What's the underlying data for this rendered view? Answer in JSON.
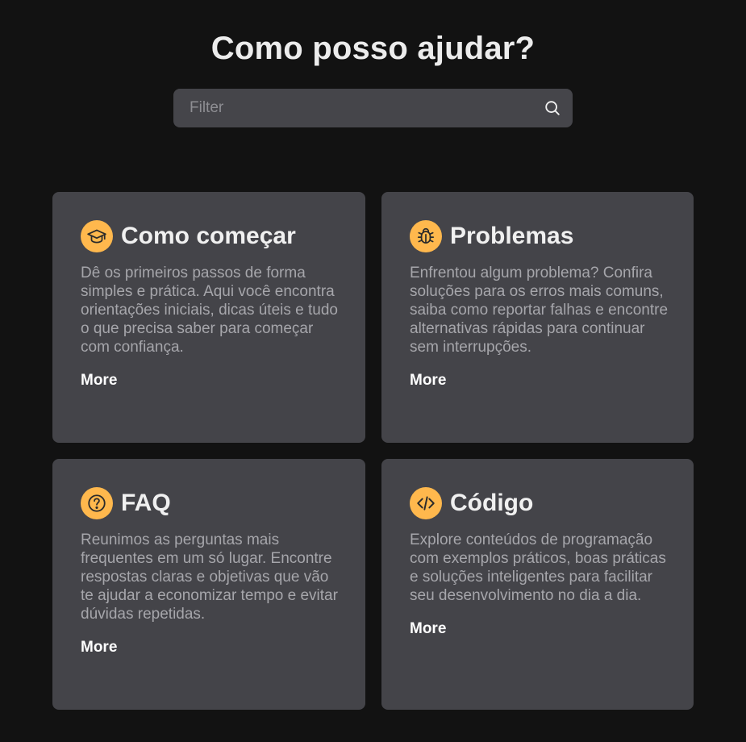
{
  "header": {
    "title": "Como posso ajudar?"
  },
  "search": {
    "placeholder": "Filter",
    "value": "",
    "icon": "search-icon"
  },
  "accent_color": "#ffb84d",
  "cards": [
    {
      "icon": "graduation-cap-icon",
      "title": "Como começar",
      "description": "Dê os primeiros passos de forma simples e prática. Aqui você encontra orientações iniciais, dicas úteis e tudo o que precisa saber para começar com confiança.",
      "link": "More"
    },
    {
      "icon": "bug-icon",
      "title": "Problemas",
      "description": "Enfrentou algum problema? Confira soluções para os erros mais comuns, saiba como reportar falhas e encontre alternativas rápidas para continuar sem interrupções.",
      "link": "More"
    },
    {
      "icon": "question-icon",
      "title": "FAQ",
      "description": "Reunimos as perguntas mais frequentes em um só lugar. Encontre respostas claras e objetivas que vão te ajudar a economizar tempo e evitar dúvidas repetidas.",
      "link": "More"
    },
    {
      "icon": "code-icon",
      "title": "Código",
      "description": "Explore conteúdos de programação com exemplos práticos, boas práticas e soluções inteligentes para facilitar seu desenvolvimento no dia a dia.",
      "link": "More"
    }
  ]
}
